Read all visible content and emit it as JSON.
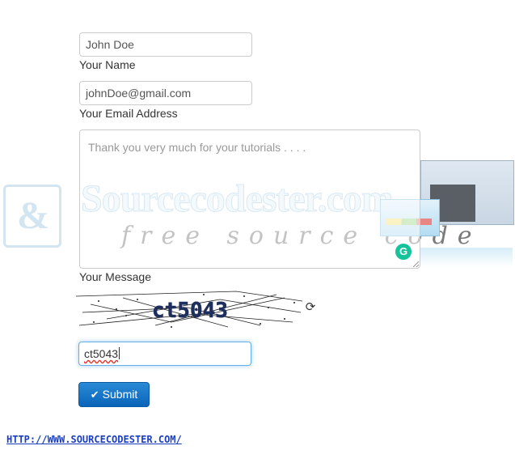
{
  "watermark": {
    "brand": "Sourcecodester.com",
    "tagline": "free source code"
  },
  "form": {
    "name": {
      "value": "John Doe",
      "label": "Your Name"
    },
    "email": {
      "value": "johnDoe@gmail.com",
      "label": "Your Email Address"
    },
    "message": {
      "value": "Thank you very much for your tutorials . . . .",
      "label": "Your Message"
    },
    "captcha": {
      "code": "ct5043",
      "input_value": "ct5043"
    },
    "submit_label": "Submit"
  },
  "icons": {
    "refresh": "refresh-icon",
    "check": "check-icon",
    "grammarly": "grammarly-icon"
  },
  "colors": {
    "button": "#0a64b8",
    "focus_border": "#66afe9",
    "link": "#1b3fbf",
    "grammarly": "#15c39a"
  },
  "footer": {
    "link_text": "HTTP://WWW.SOURCECODESTER.COM/"
  }
}
